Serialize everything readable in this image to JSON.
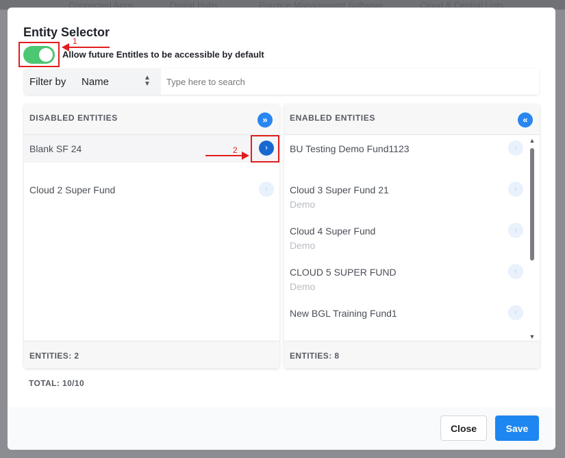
{
  "background": {
    "nav_items": [
      "Connected Apps",
      "Digital Hubs",
      "Practice Management Software",
      "Cloud & Central Lists"
    ]
  },
  "modal": {
    "title": "Entity Selector",
    "toggle": {
      "on": true,
      "label": "Allow future Entitles to be accessible by default",
      "color": "#4cc772"
    },
    "filter": {
      "label": "Filter by",
      "selected": "Name",
      "search_placeholder": "Type here to search",
      "search_value": ""
    },
    "disabled_panel": {
      "title": "DISABLED ENTITIES",
      "move_all_icon": "double-chevron-right-icon",
      "items": [
        {
          "name": "Blank SF 24",
          "sub": "",
          "highlighted": true
        },
        {
          "name": "Cloud 2 Super Fund",
          "sub": "",
          "highlighted": false
        }
      ],
      "count_label": "ENTITIES: 2"
    },
    "enabled_panel": {
      "title": "ENABLED ENTITIES",
      "move_all_icon": "double-chevron-left-icon",
      "items": [
        {
          "name": "BU Testing Demo Fund1123",
          "sub": ""
        },
        {
          "name": "Cloud 3 Super Fund 21",
          "sub": "Demo"
        },
        {
          "name": "Cloud 4 Super Fund",
          "sub": "Demo"
        },
        {
          "name": "CLOUD 5 SUPER FUND",
          "sub": "Demo"
        },
        {
          "name": "New BGL Training Fund1",
          "sub": ""
        }
      ],
      "count_label": "ENTITIES: 8"
    },
    "total_label": "TOTAL: 10/10",
    "buttons": {
      "close": "Close",
      "save": "Save"
    },
    "accent_color": "#1e86f0"
  },
  "annotations": {
    "step1": "1",
    "step2": "2",
    "color": "#e11d1d"
  }
}
